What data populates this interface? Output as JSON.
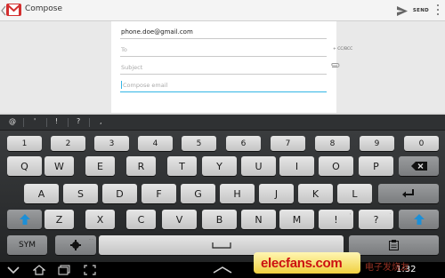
{
  "app": {
    "title": "Compose"
  },
  "toolbar": {
    "send_label": "SEND"
  },
  "compose": {
    "from": "phone.doe@gmail.com",
    "to_placeholder": "To",
    "cc_bcc_label": "+ CC/BCC",
    "subject_placeholder": "Subject",
    "body_placeholder": "Compose email"
  },
  "suggestions": [
    "@",
    "'",
    "!",
    "?",
    ","
  ],
  "keyboard": {
    "row_numbers": [
      "1",
      "2",
      "3",
      "4",
      "5",
      "6",
      "7",
      "8",
      "9",
      "0"
    ],
    "row_1": [
      "Q",
      "W",
      "E",
      "R",
      "T",
      "Y",
      "U",
      "I",
      "O",
      "P"
    ],
    "row_2": [
      "A",
      "S",
      "D",
      "F",
      "G",
      "H",
      "J",
      "K",
      "L"
    ],
    "row_3": [
      "Z",
      "X",
      "C",
      "V",
      "B",
      "N",
      "M",
      "!",
      "?"
    ],
    "row_3_small": [
      "",
      "",
      "",
      "",
      "",
      "",
      "",
      ",",
      "."
    ],
    "sym_label": "SYM",
    "space_small": "...."
  },
  "watermark": {
    "text": "elecfans.com",
    "cn": "电子发烧友"
  },
  "status": {
    "time": "1:32"
  },
  "colors": {
    "accent": "#33b5e5",
    "gmail_red": "#d32f2f"
  }
}
